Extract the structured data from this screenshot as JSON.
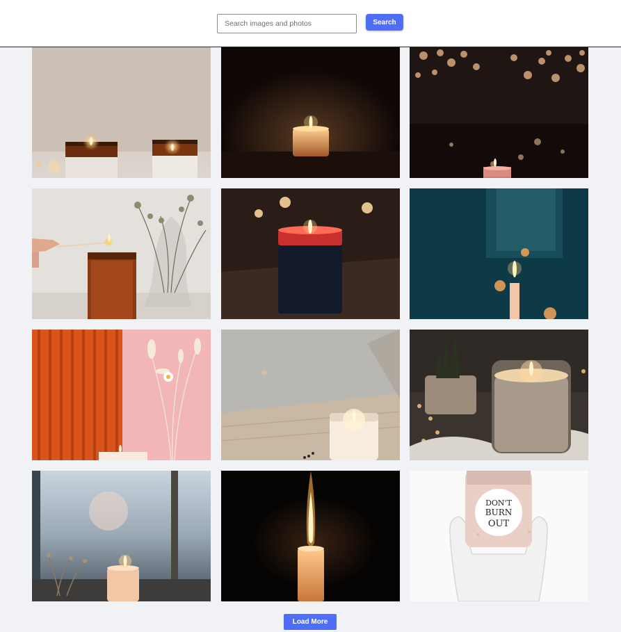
{
  "search": {
    "placeholder": "Search images and photos",
    "value": "",
    "button_label": "Search"
  },
  "gallery": {
    "photos": [
      {
        "subject": "two amber jar candles on light shelf"
      },
      {
        "subject": "single candle glowing in darkness"
      },
      {
        "subject": "small candle on reflective table with bokeh lights"
      },
      {
        "subject": "hand lighting amber jar candle with match beside dried flowers"
      },
      {
        "subject": "red-rimmed dark jar candle with bokeh lights"
      },
      {
        "subject": "thin taper candle against teal background"
      },
      {
        "subject": "orange ribbed panel and pink background with dried flowers"
      },
      {
        "subject": "glass jar candle on wooden board"
      },
      {
        "subject": "glass jar candle beside small plant and fur"
      },
      {
        "subject": "pillar candle on windowsill with dried flowers"
      },
      {
        "subject": "tall flame of pillar candle in darkness"
      },
      {
        "subject": "gloved hands holding candle jar"
      }
    ],
    "jar_label": [
      "DON'T",
      "BURN",
      "OUT"
    ],
    "load_more_label": "Load More"
  },
  "colors": {
    "accent": "#4f6ef7",
    "page_background": "#f1f2f5"
  }
}
